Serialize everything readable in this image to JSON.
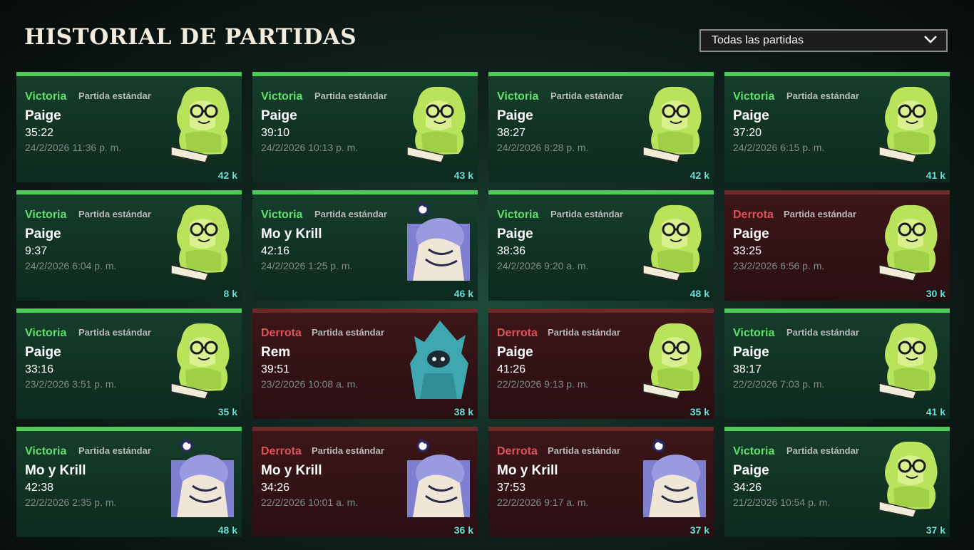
{
  "header": {
    "title": "HISTORIAL DE PARTIDAS"
  },
  "filter": {
    "selected": "Todas las partidas"
  },
  "colors": {
    "victory": "#5fe06c",
    "defeat": "#e0525a",
    "victory_bar": "#4fc95a",
    "souls": "#69e6dc"
  },
  "matches": [
    {
      "result": "Victoria",
      "outcome": "win",
      "mode": "Partida estándar",
      "hero": "Paige",
      "duration": "35:22",
      "date": "24/2/2026 11:36 p. m.",
      "souls": "42 k"
    },
    {
      "result": "Victoria",
      "outcome": "win",
      "mode": "Partida estándar",
      "hero": "Paige",
      "duration": "39:10",
      "date": "24/2/2026 10:13 p. m.",
      "souls": "43 k"
    },
    {
      "result": "Victoria",
      "outcome": "win",
      "mode": "Partida estándar",
      "hero": "Paige",
      "duration": "38:27",
      "date": "24/2/2026 8:28 p. m.",
      "souls": "42 k"
    },
    {
      "result": "Victoria",
      "outcome": "win",
      "mode": "Partida estándar",
      "hero": "Paige",
      "duration": "37:20",
      "date": "24/2/2026 6:15 p. m.",
      "souls": "41 k"
    },
    {
      "result": "Victoria",
      "outcome": "win",
      "mode": "Partida estándar",
      "hero": "Paige",
      "duration": "9:37",
      "date": "24/2/2026 6:04 p. m.",
      "souls": "8 k"
    },
    {
      "result": "Victoria",
      "outcome": "win",
      "mode": "Partida estándar",
      "hero": "Mo y Krill",
      "duration": "42:16",
      "date": "24/2/2026 1:25 p. m.",
      "souls": "46 k"
    },
    {
      "result": "Victoria",
      "outcome": "win",
      "mode": "Partida estándar",
      "hero": "Paige",
      "duration": "38:36",
      "date": "24/2/2026 9:20 a. m.",
      "souls": "48 k"
    },
    {
      "result": "Derrota",
      "outcome": "loss",
      "mode": "Partida estándar",
      "hero": "Paige",
      "duration": "33:25",
      "date": "23/2/2026 6:56 p. m.",
      "souls": "30 k"
    },
    {
      "result": "Victoria",
      "outcome": "win",
      "mode": "Partida estándar",
      "hero": "Paige",
      "duration": "33:16",
      "date": "23/2/2026 3:51 p. m.",
      "souls": "35 k"
    },
    {
      "result": "Derrota",
      "outcome": "loss",
      "mode": "Partida estándar",
      "hero": "Rem",
      "duration": "39:51",
      "date": "23/2/2026 10:08 a. m.",
      "souls": "38 k"
    },
    {
      "result": "Derrota",
      "outcome": "loss",
      "mode": "Partida estándar",
      "hero": "Paige",
      "duration": "41:26",
      "date": "22/2/2026 9:13 p. m.",
      "souls": "35 k"
    },
    {
      "result": "Victoria",
      "outcome": "win",
      "mode": "Partida estándar",
      "hero": "Paige",
      "duration": "38:17",
      "date": "22/2/2026 7:03 p. m.",
      "souls": "41 k"
    },
    {
      "result": "Victoria",
      "outcome": "win",
      "mode": "Partida estándar",
      "hero": "Mo y Krill",
      "duration": "42:38",
      "date": "22/2/2026 2:35 p. m.",
      "souls": "48 k"
    },
    {
      "result": "Derrota",
      "outcome": "loss",
      "mode": "Partida estándar",
      "hero": "Mo y Krill",
      "duration": "34:26",
      "date": "22/2/2026 10:01 a. m.",
      "souls": "36 k"
    },
    {
      "result": "Derrota",
      "outcome": "loss",
      "mode": "Partida estándar",
      "hero": "Mo y Krill",
      "duration": "37:53",
      "date": "22/2/2026 9:17 a. m.",
      "souls": "37 k"
    },
    {
      "result": "Victoria",
      "outcome": "win",
      "mode": "Partida estándar",
      "hero": "Paige",
      "duration": "34:26",
      "date": "21/2/2026 10:54 p. m.",
      "souls": "37 k"
    }
  ]
}
